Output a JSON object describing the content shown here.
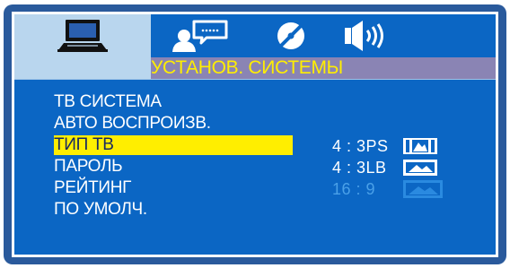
{
  "tabs": [
    {
      "name": "tab-system",
      "icon": "tv-monitor-icon",
      "active": true
    },
    {
      "name": "tab-language",
      "icon": "person-speech-icon",
      "active": false
    },
    {
      "name": "tab-video",
      "icon": "disc-icon",
      "active": false
    },
    {
      "name": "tab-audio",
      "icon": "speaker-icon",
      "active": false
    }
  ],
  "title": "УСТАНОВ. СИСТЕМЫ",
  "menu": {
    "items": [
      {
        "label": "ТВ СИСТЕМА"
      },
      {
        "label": "АВТО ВОСПРОИЗВ."
      },
      {
        "label": "ТИП ТВ"
      },
      {
        "label": "ПАРОЛЬ"
      },
      {
        "label": "РЕЙТИНГ"
      },
      {
        "label": "ПО УМОЛЧ."
      }
    ],
    "selected_index": 2
  },
  "options": [
    {
      "label": "4 : 3PS",
      "icon": "pan-scan-icon"
    },
    {
      "label": "4 : 3LB",
      "icon": "letterbox-icon"
    },
    {
      "label": "16 : 9",
      "icon": "widescreen-icon",
      "dimmed": true
    }
  ],
  "colors": {
    "panel": "#0b66c4",
    "frame": "#2a5a9c",
    "highlight": "#ffee00",
    "title_bar": "#8a84b4",
    "active_tab": "#b9d6ee",
    "dim_text": "#4aa0e8"
  }
}
